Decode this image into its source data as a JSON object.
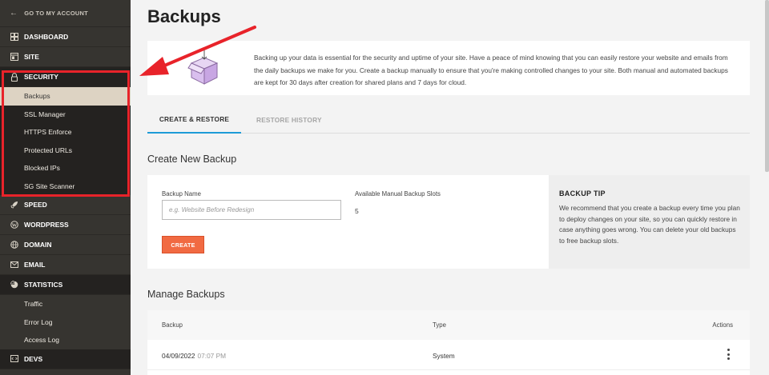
{
  "sidebar": {
    "back_label": "GO TO MY ACCOUNT",
    "items": [
      {
        "label": "DASHBOARD",
        "icon": "dashboard-icon"
      },
      {
        "label": "SITE",
        "icon": "site-icon"
      },
      {
        "label": "SECURITY",
        "icon": "lock-icon"
      },
      {
        "label": "SPEED",
        "icon": "rocket-icon"
      },
      {
        "label": "WORDPRESS",
        "icon": "wordpress-icon"
      },
      {
        "label": "DOMAIN",
        "icon": "globe-icon"
      },
      {
        "label": "EMAIL",
        "icon": "envelope-icon"
      },
      {
        "label": "STATISTICS",
        "icon": "chart-icon"
      },
      {
        "label": "DEVS",
        "icon": "code-icon"
      }
    ],
    "security_sub": [
      "Backups",
      "SSL Manager",
      "HTTPS Enforce",
      "Protected URLs",
      "Blocked IPs",
      "SG Site Scanner"
    ],
    "statistics_sub": [
      "Traffic",
      "Error Log",
      "Access Log"
    ]
  },
  "page": {
    "title": "Backups",
    "info_text": "Backing up your data is essential for the security and uptime of your site. Have a peace of mind knowing that you can easily restore your website and emails from the daily backups we make for you. Create a backup manually to ensure that you're making controlled changes to your site. Both manual and automated backups are kept for 30 days after creation for shared plans and 7 days for cloud.",
    "tabs": [
      "CREATE & RESTORE",
      "RESTORE HISTORY"
    ],
    "create_section_title": "Create New Backup",
    "backup_name_label": "Backup Name",
    "backup_name_placeholder": "e.g. Website Before Redesign",
    "slots_label": "Available Manual Backup Slots",
    "slots_value": "5",
    "create_button": "CREATE",
    "tip_title": "BACKUP TIP",
    "tip_text": "We recommend that you create a backup every time you plan to deploy changes on your site, so you can quickly restore in case anything goes wrong. You can delete your old backups to free backup slots.",
    "manage_section_title": "Manage Backups",
    "table": {
      "columns": [
        "Backup",
        "Type",
        "Actions"
      ],
      "rows": [
        {
          "date": "04/09/2022",
          "time": "07:07 PM",
          "type": "System"
        }
      ]
    }
  },
  "colors": {
    "sidebar_bg": "#363430",
    "active_sub_bg": "#ddd3c3",
    "highlight": "#e8232a",
    "accent_tab": "#1e9bd7",
    "create_button": "#f16a42"
  }
}
